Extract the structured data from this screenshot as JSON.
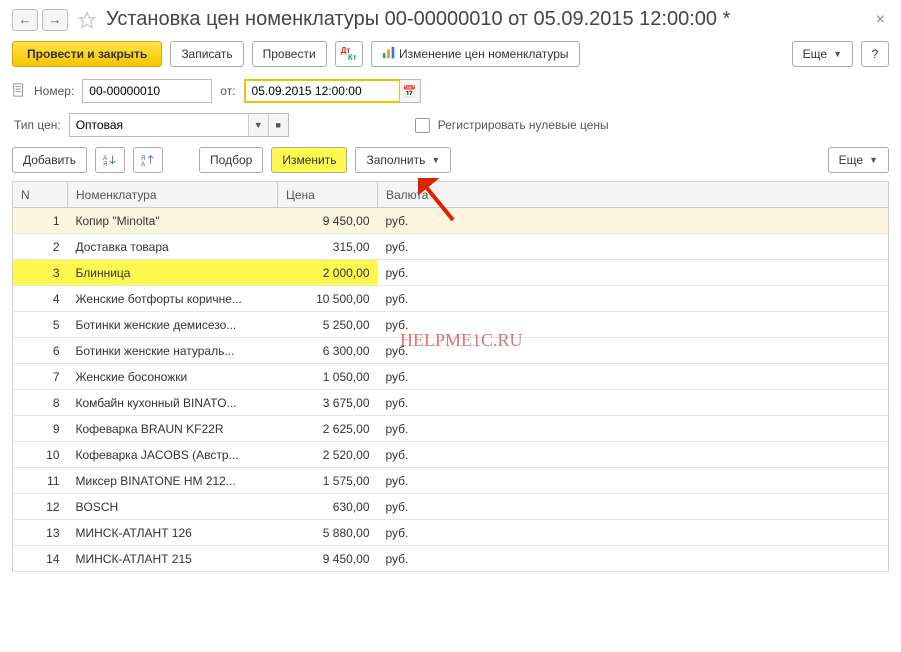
{
  "header": {
    "title": "Установка цен номенклатуры 00-00000010 от 05.09.2015 12:00:00 *"
  },
  "toolbar": {
    "post_close": "Провести и закрыть",
    "write": "Записать",
    "post": "Провести",
    "price_change": "Изменение цен номенклатуры",
    "more": "Еще"
  },
  "fields": {
    "number_label": "Номер:",
    "number_value": "00-00000010",
    "from_label": "от:",
    "date_value": "05.09.2015 12:00:00",
    "price_type_label": "Тип цен:",
    "price_type_value": "Оптовая",
    "register_zero_label": "Регистрировать нулевые цены"
  },
  "toolbar2": {
    "add": "Добавить",
    "select": "Подбор",
    "change": "Изменить",
    "fill": "Заполнить",
    "more": "Еще"
  },
  "grid": {
    "col_n": "N",
    "col_name": "Номенклатура",
    "col_price": "Цена",
    "col_currency": "Валюта",
    "rows": [
      {
        "n": "1",
        "name": "Копир \"Minolta\"",
        "price": "9 450,00",
        "cur": "руб.",
        "cls": "row-soft"
      },
      {
        "n": "2",
        "name": "Доставка товара",
        "price": "315,00",
        "cur": "руб.",
        "cls": ""
      },
      {
        "n": "3",
        "name": "Блинница",
        "price": "2 000,00",
        "cur": "руб.",
        "cls": "row-yellow"
      },
      {
        "n": "4",
        "name": "Женские ботфорты коричне...",
        "price": "10 500,00",
        "cur": "руб.",
        "cls": ""
      },
      {
        "n": "5",
        "name": "Ботинки женские демисезо...",
        "price": "5 250,00",
        "cur": "руб.",
        "cls": ""
      },
      {
        "n": "6",
        "name": "Ботинки женские натураль...",
        "price": "6 300,00",
        "cur": "руб.",
        "cls": ""
      },
      {
        "n": "7",
        "name": "Женские босоножки",
        "price": "1 050,00",
        "cur": "руб.",
        "cls": ""
      },
      {
        "n": "8",
        "name": "Комбайн кухонный BINATO...",
        "price": "3 675,00",
        "cur": "руб.",
        "cls": ""
      },
      {
        "n": "9",
        "name": "Кофеварка BRAUN KF22R",
        "price": "2 625,00",
        "cur": "руб.",
        "cls": ""
      },
      {
        "n": "10",
        "name": "Кофеварка JACOBS (Австр...",
        "price": "2 520,00",
        "cur": "руб.",
        "cls": ""
      },
      {
        "n": "11",
        "name": "Миксер BINATONE HM 212...",
        "price": "1 575,00",
        "cur": "руб.",
        "cls": ""
      },
      {
        "n": "12",
        "name": "BOSCH",
        "price": "630,00",
        "cur": "руб.",
        "cls": ""
      },
      {
        "n": "13",
        "name": "МИНСК-АТЛАНТ 126",
        "price": "5 880,00",
        "cur": "руб.",
        "cls": ""
      },
      {
        "n": "14",
        "name": "МИНСК-АТЛАНТ 215",
        "price": "9 450,00",
        "cur": "руб.",
        "cls": ""
      }
    ]
  },
  "watermark": "HELPME1C.RU"
}
